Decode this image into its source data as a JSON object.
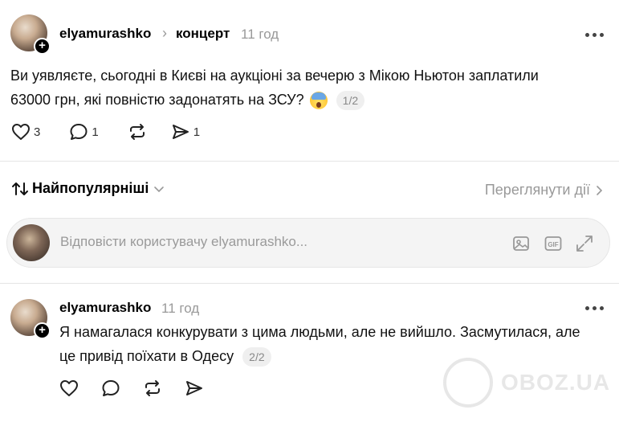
{
  "post": {
    "username": "elyamurashko",
    "topic": "концерт",
    "time": "11 год",
    "text_line1": "Ви уявляєте, сьогодні в Києві на аукціоні за вечерю з Мікою Ньютон заплатили",
    "text_line2": "63000 грн, які повністю задонатять на ЗСУ?",
    "emoji": "face-screaming-in-fear",
    "page_indicator": "1/2",
    "likes": "3",
    "comments": "1",
    "shares": "1"
  },
  "sort": {
    "label": "Найпопулярніші"
  },
  "view_activity": {
    "label": "Переглянути дії"
  },
  "reply": {
    "placeholder": "Відповісти користувачу elyamurashko..."
  },
  "comment": {
    "username": "elyamurashko",
    "time": "11 год",
    "text_line1": "Я намагалася конкурувати з цима людьми, але не вийшло. Засмутилася, але",
    "text_line2": "це привід поїхати в Одесу",
    "page_indicator": "2/2"
  },
  "watermark": {
    "text": "OBOZ.UA"
  },
  "colors": {
    "muted": "#999999",
    "background": "#ffffff",
    "divider": "#e5e5e5"
  }
}
